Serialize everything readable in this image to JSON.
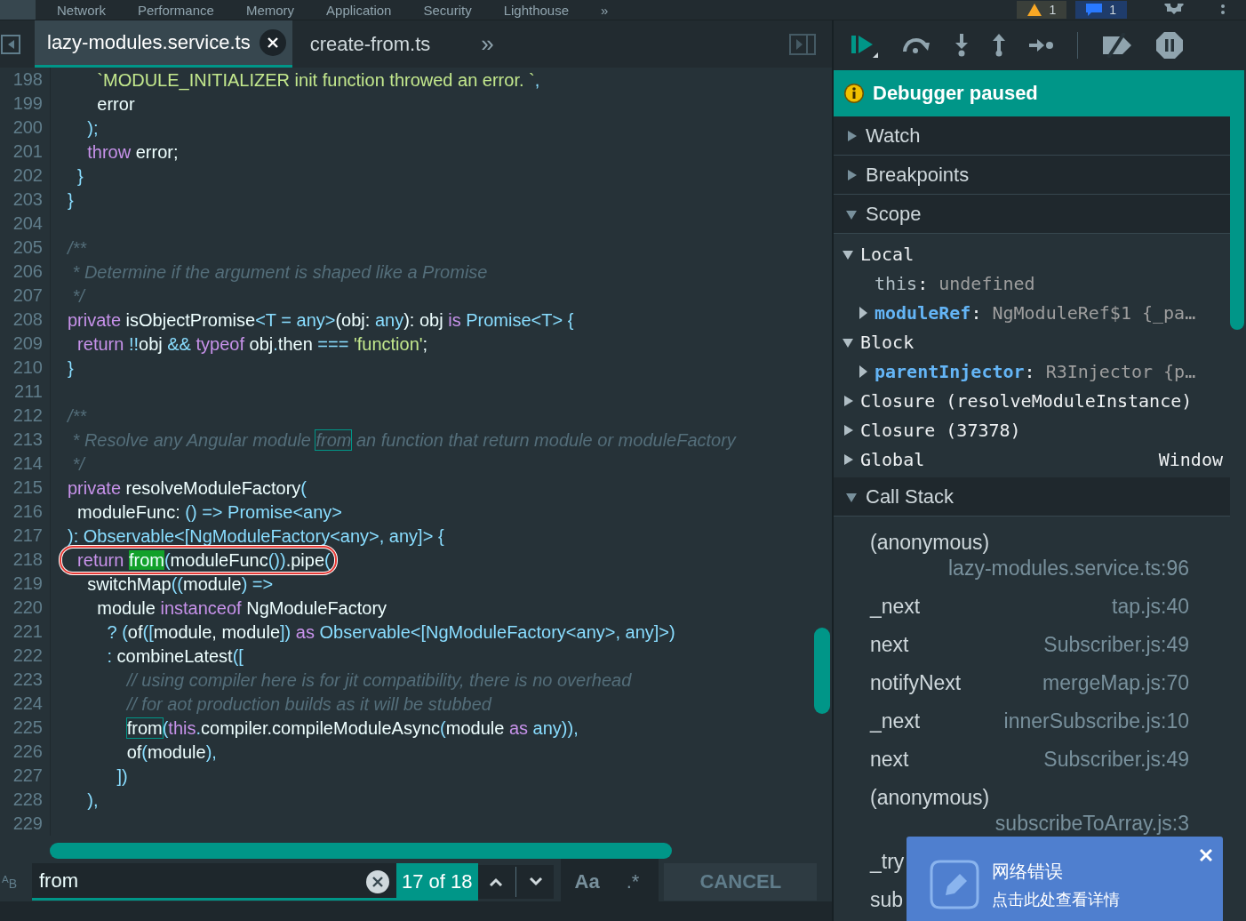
{
  "top_tabs": [
    {
      "label": "Network"
    },
    {
      "label": "Performance"
    },
    {
      "label": "Memory"
    },
    {
      "label": "Application"
    },
    {
      "label": "Security"
    },
    {
      "label": "Lighthouse"
    },
    {
      "label": "»"
    }
  ],
  "badges": [
    {
      "kind": "warning",
      "count": "1"
    },
    {
      "kind": "message",
      "count": "1"
    }
  ],
  "file_tabs": [
    {
      "label": "lazy-modules.service.ts",
      "selected": true
    },
    {
      "label": "create-from.ts",
      "selected": false
    }
  ],
  "file_tabs_more": "»",
  "code": [
    {
      "number": "198",
      "circled": false,
      "tokens": [
        {
          "kind": "string",
          "text": "      `MODULE_INITIALIZER init function throwed an error. `"
        },
        {
          "kind": "type",
          "text": ","
        }
      ]
    },
    {
      "number": "199",
      "circled": false,
      "tokens": [
        {
          "kind": "plain",
          "text": "      error"
        }
      ]
    },
    {
      "number": "200",
      "circled": false,
      "tokens": [
        {
          "kind": "type",
          "text": "    );"
        }
      ]
    },
    {
      "number": "201",
      "circled": false,
      "tokens": [
        {
          "kind": "keyword",
          "text": "    throw"
        },
        {
          "kind": "plain",
          "text": " error;"
        }
      ]
    },
    {
      "number": "202",
      "circled": false,
      "tokens": [
        {
          "kind": "type",
          "text": "  }"
        }
      ]
    },
    {
      "number": "203",
      "circled": false,
      "tokens": [
        {
          "kind": "type",
          "text": "}"
        }
      ]
    },
    {
      "number": "204"
    },
    {
      "number": "205",
      "circled": false,
      "tokens": [
        {
          "kind": "comment",
          "text": "/**"
        }
      ]
    },
    {
      "number": "206",
      "circled": false,
      "tokens": [
        {
          "kind": "comment",
          "text": " * Determine if the argument is shaped like a Promise"
        }
      ]
    },
    {
      "number": "207",
      "circled": false,
      "tokens": [
        {
          "kind": "comment",
          "text": " */"
        }
      ]
    },
    {
      "number": "208",
      "circled": false,
      "tokens": [
        {
          "kind": "keyword",
          "text": "private"
        },
        {
          "kind": "plain",
          "text": " isObjectPromise"
        },
        {
          "kind": "type",
          "text": "<T = any>"
        },
        {
          "kind": "plain",
          "text": "(obj: "
        },
        {
          "kind": "type",
          "text": "any"
        },
        {
          "kind": "plain",
          "text": "): obj "
        },
        {
          "kind": "keyword",
          "text": "is"
        },
        {
          "kind": "type",
          "text": " Promise<T> {"
        }
      ]
    },
    {
      "number": "209",
      "circled": false,
      "tokens": [
        {
          "kind": "keyword",
          "text": "  return"
        },
        {
          "kind": "type",
          "text": " !!"
        },
        {
          "kind": "plain",
          "text": "obj "
        },
        {
          "kind": "type",
          "text": "&&"
        },
        {
          "kind": "keyword",
          "text": " typeof"
        },
        {
          "kind": "plain",
          "text": " obj"
        },
        {
          "kind": "type",
          "text": "."
        },
        {
          "kind": "plain",
          "text": "then "
        },
        {
          "kind": "type",
          "text": "==="
        },
        {
          "kind": "string",
          "text": " 'function'"
        },
        {
          "kind": "plain",
          "text": ";"
        }
      ]
    },
    {
      "number": "210",
      "circled": false,
      "tokens": [
        {
          "kind": "type",
          "text": "}"
        }
      ]
    },
    {
      "number": "211"
    },
    {
      "number": "212",
      "circled": false,
      "tokens": [
        {
          "kind": "comment",
          "text": "/**"
        }
      ]
    },
    {
      "number": "213",
      "circled": false,
      "tokens": [
        {
          "kind": "comment",
          "text": " * Resolve any Angular module "
        },
        {
          "kind": "comment_match",
          "text": "from"
        },
        {
          "kind": "comment",
          "text": " an function that return module or moduleFactory"
        }
      ]
    },
    {
      "number": "214",
      "circled": false,
      "tokens": [
        {
          "kind": "comment",
          "text": " */"
        }
      ]
    },
    {
      "number": "215",
      "circled": false,
      "tokens": [
        {
          "kind": "keyword",
          "text": "private"
        },
        {
          "kind": "plain",
          "text": " resolveModuleFactory"
        },
        {
          "kind": "type",
          "text": "("
        }
      ]
    },
    {
      "number": "216",
      "circled": false,
      "tokens": [
        {
          "kind": "plain",
          "text": "  moduleFunc: "
        },
        {
          "kind": "type",
          "text": "() => Promise<any>"
        }
      ]
    },
    {
      "number": "217",
      "circled": false,
      "tokens": [
        {
          "kind": "type",
          "text": "): Observable<[NgModuleFactory<any>, any]> {"
        }
      ]
    },
    {
      "number": "218",
      "circled": true,
      "tokens": [
        {
          "kind": "keyword",
          "text": "  return "
        },
        {
          "kind": "current_match",
          "text": "from"
        },
        {
          "kind": "type",
          "text": "("
        },
        {
          "kind": "plain",
          "text": "moduleFunc"
        },
        {
          "kind": "type",
          "text": "())"
        },
        {
          "kind": "plain",
          "text": ".pipe"
        },
        {
          "kind": "type",
          "text": "("
        }
      ]
    },
    {
      "number": "219",
      "circled": false,
      "tokens": [
        {
          "kind": "plain",
          "text": "    switchMap"
        },
        {
          "kind": "type",
          "text": "(("
        },
        {
          "kind": "plain",
          "text": "module"
        },
        {
          "kind": "type",
          "text": ") =>"
        }
      ]
    },
    {
      "number": "220",
      "circled": false,
      "tokens": [
        {
          "kind": "plain",
          "text": "      module "
        },
        {
          "kind": "keyword",
          "text": "instanceof"
        },
        {
          "kind": "plain",
          "text": " NgModuleFactory"
        }
      ]
    },
    {
      "number": "221",
      "circled": false,
      "tokens": [
        {
          "kind": "type",
          "text": "        ? ("
        },
        {
          "kind": "plain",
          "text": "of"
        },
        {
          "kind": "type",
          "text": "(["
        },
        {
          "kind": "plain",
          "text": "module, module"
        },
        {
          "kind": "type",
          "text": "])"
        },
        {
          "kind": "keyword",
          "text": " as"
        },
        {
          "kind": "type",
          "text": " Observable<[NgModuleFactory<any>, any]>)"
        }
      ]
    },
    {
      "number": "222",
      "circled": false,
      "tokens": [
        {
          "kind": "type",
          "text": "        : "
        },
        {
          "kind": "plain",
          "text": "combineLatest"
        },
        {
          "kind": "type",
          "text": "(["
        }
      ]
    },
    {
      "number": "223",
      "circled": false,
      "tokens": [
        {
          "kind": "comment",
          "text": "            // using compiler here is for jit compatibility, there is no overhead"
        }
      ]
    },
    {
      "number": "224",
      "circled": false,
      "tokens": [
        {
          "kind": "comment",
          "text": "            // for aot production builds as it will be stubbed"
        }
      ]
    },
    {
      "number": "225",
      "circled": false,
      "tokens": [
        {
          "kind": "match",
          "text": "            from"
        },
        {
          "kind": "type",
          "text": "("
        },
        {
          "kind": "keyword",
          "text": "this"
        },
        {
          "kind": "type",
          "text": "."
        },
        {
          "kind": "plain",
          "text": "compiler.compileModuleAsync"
        },
        {
          "kind": "type",
          "text": "("
        },
        {
          "kind": "plain",
          "text": "module "
        },
        {
          "kind": "keyword",
          "text": "as"
        },
        {
          "kind": "type",
          "text": " any)),"
        }
      ]
    },
    {
      "number": "226",
      "circled": false,
      "tokens": [
        {
          "kind": "plain",
          "text": "            of"
        },
        {
          "kind": "type",
          "text": "("
        },
        {
          "kind": "plain",
          "text": "module"
        },
        {
          "kind": "type",
          "text": "),"
        }
      ]
    },
    {
      "number": "227",
      "circled": false,
      "tokens": [
        {
          "kind": "type",
          "text": "          ])"
        }
      ]
    },
    {
      "number": "228",
      "circled": false,
      "tokens": [
        {
          "kind": "type",
          "text": "    ),"
        }
      ]
    },
    {
      "number": "229"
    }
  ],
  "search": {
    "replace_toggle": "$^{A}$B",
    "value": "from",
    "count": "17 of 18",
    "case_toggle": "Aa",
    "regex_toggle": ".*",
    "cancel": "CANCEL"
  },
  "debugger": {
    "status": "Debugger paused",
    "sections": [
      {
        "title": "Watch",
        "expanded": false
      },
      {
        "title": "Breakpoints",
        "expanded": false
      },
      {
        "title": "Scope",
        "expanded": true
      },
      {
        "title": "Call Stack",
        "expanded": true
      }
    ],
    "scopes": [
      {
        "label": "Local",
        "expanded": true,
        "children": [
          {
            "kind": "primitive",
            "name": "this",
            "separator": ":",
            "value": "undefined"
          },
          {
            "kind": "object",
            "name": "moduleRef",
            "separator": ":",
            "value": "NgModuleRef$1 {_pa…",
            "expanded": false
          }
        ]
      },
      {
        "label": "Block",
        "expanded": true,
        "children": [
          {
            "kind": "object",
            "name": "parentInjector",
            "separator": ":",
            "value": "R3Injector {p…",
            "expanded": false
          }
        ]
      },
      {
        "label": "Closure (resolveModuleInstance)",
        "expanded": false
      },
      {
        "label": "Closure (37378)",
        "expanded": false
      },
      {
        "label": "Global",
        "value": "Window",
        "expanded": false
      }
    ],
    "call_stack": [
      {
        "function": "(anonymous)",
        "location": "lazy-modules.service.ts:96"
      },
      {
        "function": "_next",
        "location": "tap.js:40"
      },
      {
        "function": "next",
        "location": "Subscriber.js:49"
      },
      {
        "function": "notifyNext",
        "location": "mergeMap.js:70"
      },
      {
        "function": "_next",
        "location": "innerSubscribe.js:10"
      },
      {
        "function": "next",
        "location": "Subscriber.js:49"
      },
      {
        "function": "(anonymous)",
        "location": "subscribeToArray.js:3"
      },
      {
        "function": "_try"
      },
      {
        "function": "sub"
      }
    ]
  },
  "toast": {
    "title": "网络错误",
    "message": "点击此处查看详情"
  }
}
